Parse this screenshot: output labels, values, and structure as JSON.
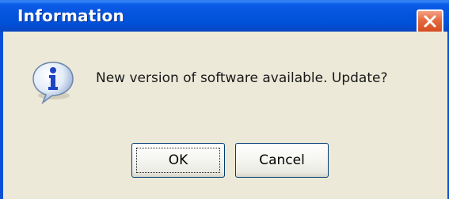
{
  "window": {
    "title": "Information"
  },
  "dialog": {
    "message": "New version of software available. Update?",
    "icon": "information-icon"
  },
  "buttons": {
    "ok_label": "OK",
    "cancel_label": "Cancel"
  },
  "colors": {
    "titlebar": "#0654dd",
    "close_button": "#e46a3f",
    "dialog_background": "#ece9d8",
    "button_border": "#003c74"
  }
}
